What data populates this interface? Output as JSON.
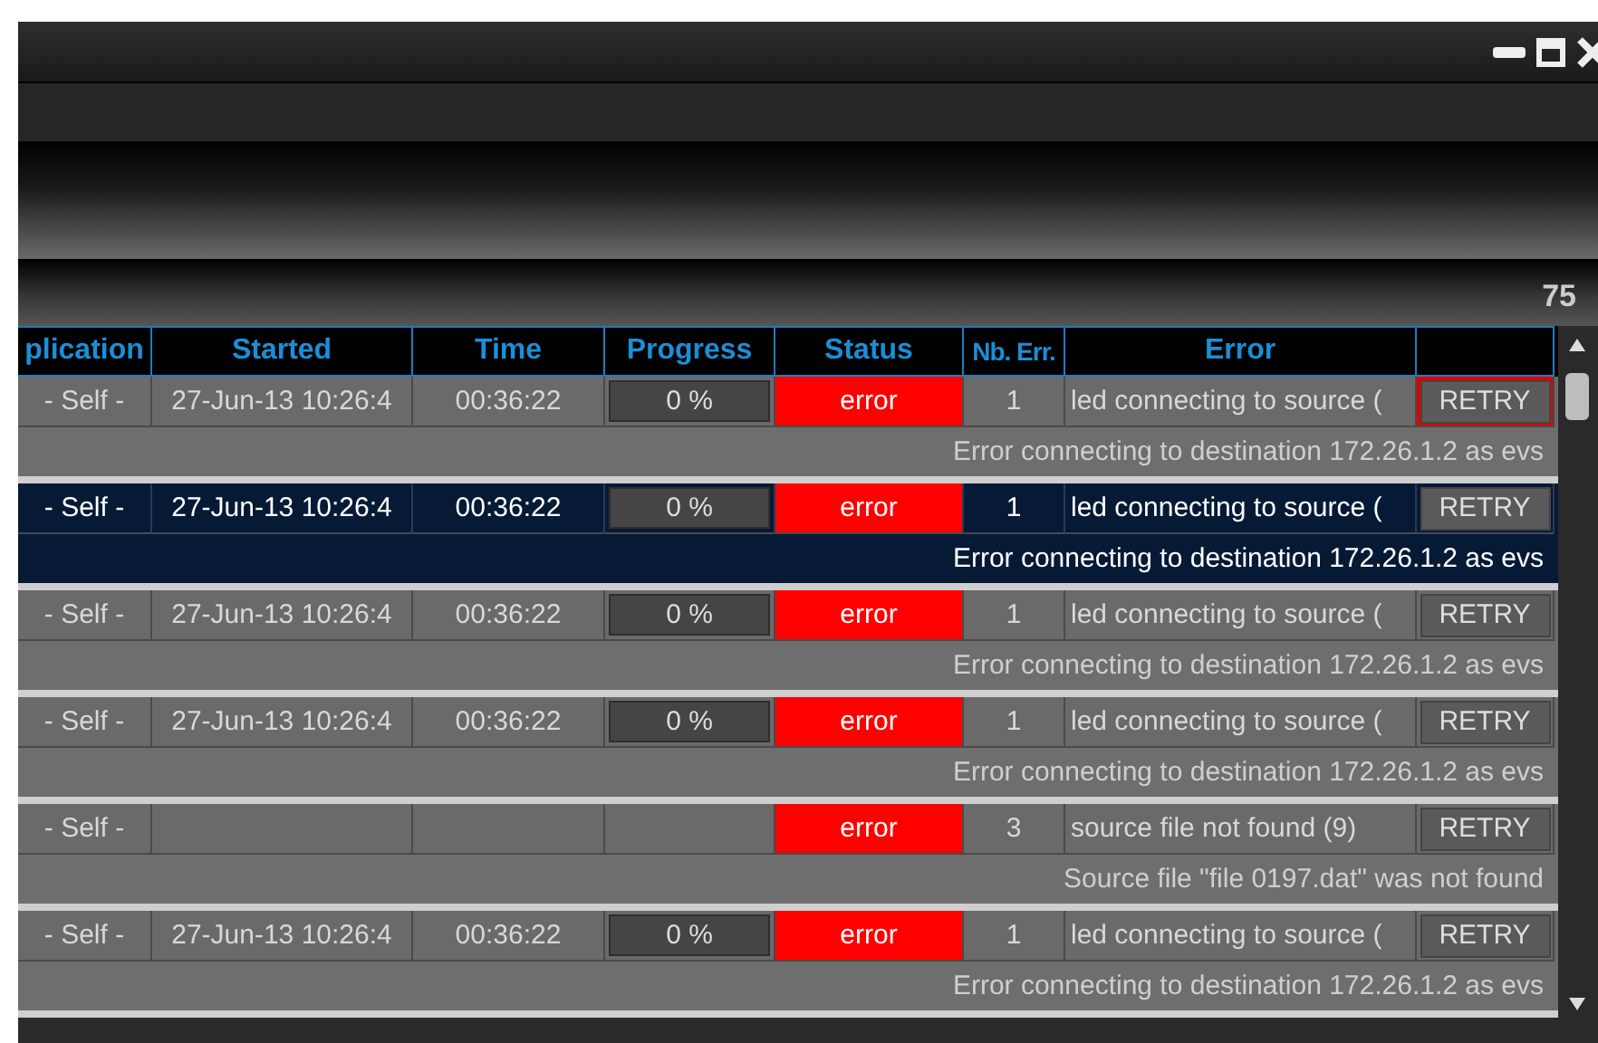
{
  "count": "75",
  "columns": [
    "plication",
    "Started",
    "Time",
    "Progress",
    "Status",
    "Nb. Err.",
    "Error",
    ""
  ],
  "rows": [
    {
      "selected": false,
      "application": "- Self -",
      "started": "27-Jun-13 10:26:4",
      "time": "00:36:22",
      "progress": "0 %",
      "status": "error",
      "errors": "1",
      "error": "led connecting to source (",
      "action": "RETRY",
      "highlighted": true,
      "detail": "Error connecting to destination 172.26.1.2 as evs"
    },
    {
      "selected": true,
      "application": "- Self -",
      "started": "27-Jun-13 10:26:4",
      "time": "00:36:22",
      "progress": "0 %",
      "status": "error",
      "errors": "1",
      "error": "led connecting to source (",
      "action": "RETRY",
      "highlighted": false,
      "detail": "Error connecting to destination 172.26.1.2 as evs"
    },
    {
      "selected": false,
      "application": "- Self -",
      "started": "27-Jun-13 10:26:4",
      "time": "00:36:22",
      "progress": "0 %",
      "status": "error",
      "errors": "1",
      "error": "led connecting to source (",
      "action": "RETRY",
      "highlighted": false,
      "detail": "Error connecting to destination 172.26.1.2 as evs"
    },
    {
      "selected": false,
      "application": "- Self -",
      "started": "27-Jun-13 10:26:4",
      "time": "00:36:22",
      "progress": "0 %",
      "status": "error",
      "errors": "1",
      "error": "led connecting to source (",
      "action": "RETRY",
      "highlighted": false,
      "detail": "Error connecting to destination 172.26.1.2 as evs"
    },
    {
      "selected": false,
      "application": "- Self -",
      "status": "error",
      "errors": "3",
      "error": "source file not found (9)",
      "action": "RETRY",
      "highlighted": false,
      "detail": "Source file \"file 0197.dat\" was not found"
    },
    {
      "selected": false,
      "application": "- Self -",
      "started": "27-Jun-13 10:26:4",
      "time": "00:36:22",
      "progress": "0 %",
      "status": "error",
      "errors": "1",
      "error": "led connecting to source (",
      "action": "RETRY",
      "highlighted": false,
      "detail": "Error connecting to destination 172.26.1.2 as evs"
    }
  ]
}
